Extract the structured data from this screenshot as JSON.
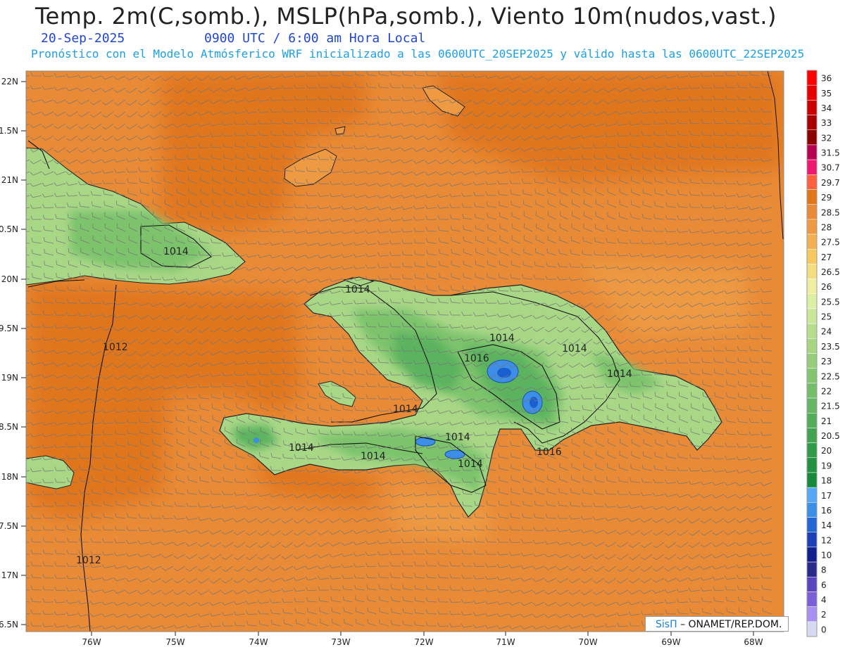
{
  "header": {
    "title": "Temp. 2m(C,somb.), MSLP(hPa,somb.), Viento 10m(nudos,vast.)",
    "date": "20-Sep-2025",
    "time": "0900 UTC / 6:00 am Hora Local",
    "info": "Pronóstico con el Modelo Atmósferico WRF inicializado a las 0600UTC_20SEP2025 y válido hasta las  0600UTC_22SEP2025"
  },
  "credit": {
    "logo_text": "SisΠ",
    "rest": "– ONAMET/REP.DOM."
  },
  "map": {
    "lat_labels": [
      "22N",
      "1.5N",
      "21N",
      "0.5N",
      "20N",
      "9.5N",
      "19N",
      "8.5N",
      "18N",
      "7.5N",
      "17N",
      "6.5N"
    ],
    "lon_labels": [
      "76W",
      "75W",
      "74W",
      "73W",
      "72W",
      "71W",
      "70W",
      "69W",
      "68W"
    ],
    "isobar_labels": [
      "1014",
      "1014",
      "1012",
      "1012",
      "1014",
      "1014",
      "1016",
      "1014",
      "1014",
      "1014",
      "1014",
      "1014",
      "1014",
      "1016",
      "1014"
    ],
    "colors": {
      "sea": "#e98a36",
      "sea_dark": "#e0761a",
      "land_low": "#bde292",
      "land_mid": "#8fcb73",
      "land_high": "#5bb35f",
      "cold": "#3c8ee6",
      "wind": "#777777"
    }
  },
  "colorbar": {
    "labels": [
      "36",
      "35",
      "34",
      "33",
      "32",
      "31.5",
      "30.7",
      "29.7",
      "29",
      "28.5",
      "28",
      "27.5",
      "27",
      "26.5",
      "26",
      "25.5",
      "25",
      "24",
      "23.5",
      "23",
      "22.5",
      "22",
      "21.5",
      "21",
      "20.5",
      "20",
      "19",
      "18",
      "17",
      "16",
      "14",
      "12",
      "10",
      "8",
      "6",
      "4",
      "2",
      "0"
    ],
    "colors": [
      "#ff0000",
      "#e60000",
      "#cc0000",
      "#a80000",
      "#8b0000",
      "#b80050",
      "#ee1a70",
      "#ff6040",
      "#e0761a",
      "#e98a36",
      "#ed9a42",
      "#f2b050",
      "#f6c860",
      "#f4dc80",
      "#eef0a0",
      "#dcefa5",
      "#c9e69a",
      "#b6dd8e",
      "#a6d584",
      "#96cd7b",
      "#85c572",
      "#75bd6a",
      "#65b562",
      "#52ac5a",
      "#40a452",
      "#2f9b4a",
      "#229242",
      "#17893b",
      "#54a8f5",
      "#3b8fe8",
      "#2266d6",
      "#1a3fb6",
      "#101f8c",
      "#2a2a8a",
      "#5a44c0",
      "#7a60d8",
      "#a890f0",
      "#d8d8f0"
    ]
  }
}
